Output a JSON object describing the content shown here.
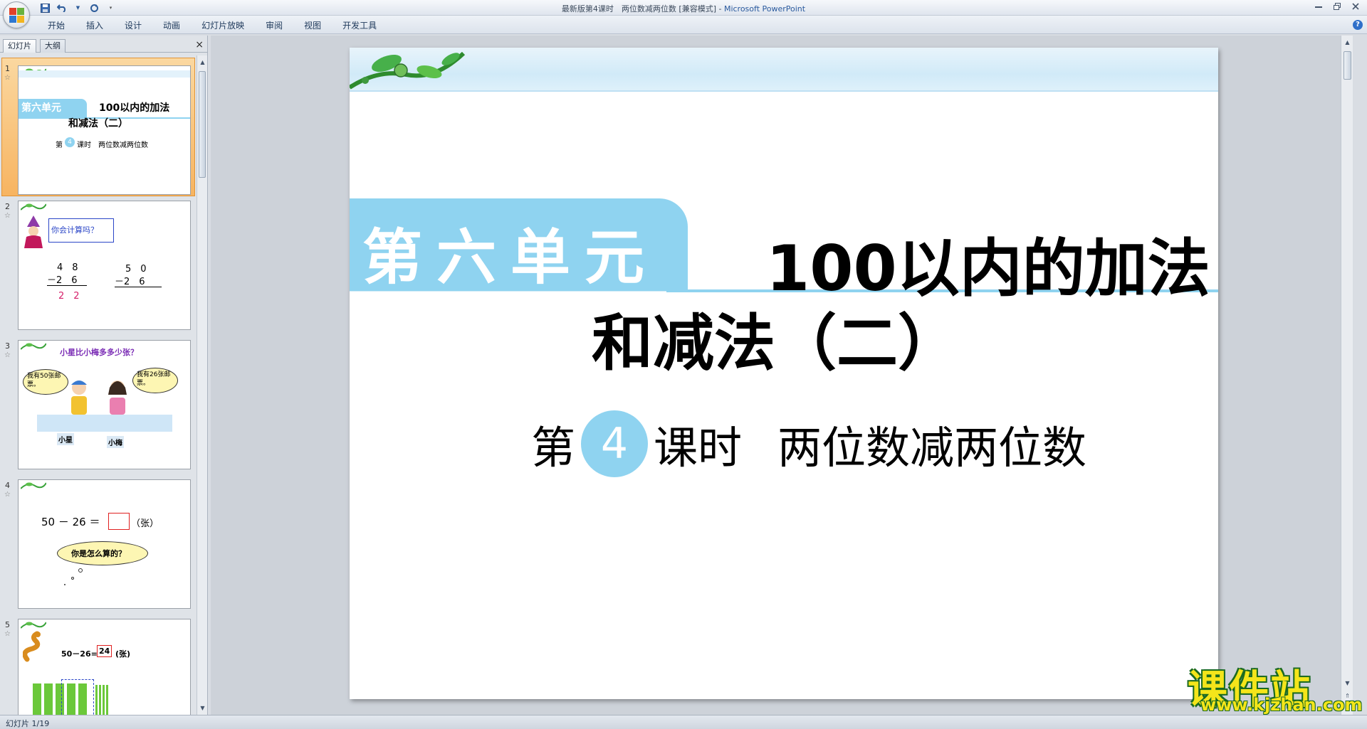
{
  "window": {
    "title_doc": "最新版第4课时　两位数减两位数 [兼容模式]",
    "title_sep": " - ",
    "title_app": "Microsoft PowerPoint"
  },
  "qat": {
    "icons": [
      "save-icon",
      "undo-icon",
      "redo-icon",
      "customize-icon"
    ]
  },
  "ribbon": {
    "tabs": [
      "开始",
      "插入",
      "设计",
      "动画",
      "幻灯片放映",
      "审阅",
      "视图",
      "开发工具"
    ]
  },
  "left_pane": {
    "tab_slides": "幻灯片",
    "tab_outline": "大纲",
    "close": "×"
  },
  "thumbnails": [
    {
      "num": "1",
      "title_a": "第六单元",
      "title_b": "100以内的加法",
      "title_c": "和减法（二）",
      "sub_a": "第",
      "sub_num": "4",
      "sub_b": "课时　两位数减两位数"
    },
    {
      "num": "2",
      "bubble": "你会计算吗？",
      "a1": "4　8",
      "a2": "－2　6",
      "a3": "2　2",
      "b1": "5　0",
      "b2": "－2　6"
    },
    {
      "num": "3",
      "question": "小星比小梅多多少张？",
      "bubble1": "我有50张邮票。",
      "bubble2": "我有26张邮票。",
      "name1": "小星",
      "name2": "小梅"
    },
    {
      "num": "4",
      "expr": "50 － 26 ＝",
      "unit": "（张）",
      "cloud": "你是怎么算的？"
    },
    {
      "num": "5",
      "expr": "50－26=",
      "answer": "24",
      "unit": "(张)"
    }
  ],
  "slide": {
    "unit": "第六单元",
    "title_line1": "100以内的加法",
    "title_line2": "和减法（二）",
    "lesson_prefix": "第",
    "lesson_num": "4",
    "lesson_suffix": "课时",
    "lesson_topic": "两位数减两位数",
    "accent_color": "#8fd3f0"
  },
  "watermark": {
    "title": "课件站",
    "url": "www.kjzhan.com"
  },
  "status": {
    "slide_info": "幻灯片 1/19"
  }
}
